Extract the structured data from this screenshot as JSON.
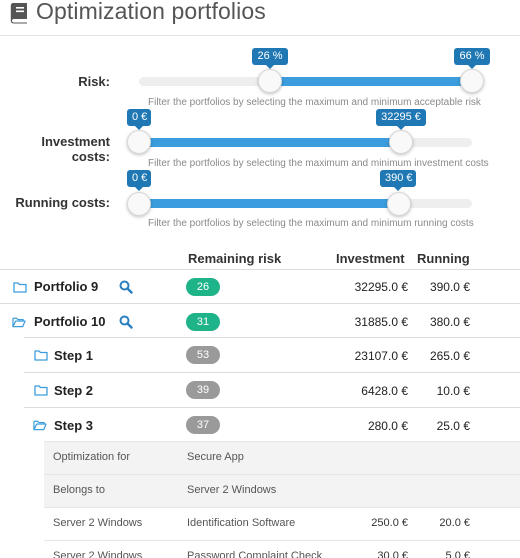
{
  "header": {
    "title": "Optimization portfolios",
    "icon": "book-icon"
  },
  "sliders": [
    {
      "label": "Risk:",
      "min_value": "26 %",
      "max_value": "66 %",
      "min_fraction": 0.26,
      "max_fraction": 0.66,
      "hint": "Filter the portfolios by selecting the maximum and minimum acceptable risk"
    },
    {
      "label": "Investment costs:",
      "min_value": "0 €",
      "max_value": "32295 €",
      "hint": "Filter the portfolios by selecting the maximum and minimum investment costs"
    },
    {
      "label": "Running costs:",
      "min_value": "0 €",
      "max_value": "390 €",
      "hint": "Filter the portfolios by selecting the maximum and minimum running costs"
    }
  ],
  "table": {
    "headers": {
      "risk": "Remaining risk",
      "investment": "Investment",
      "running": "Running"
    },
    "rows": [
      {
        "name": "Portfolio 9",
        "risk": "26",
        "investment": "32295.0 €",
        "running": "390.0 €",
        "expanded": false
      },
      {
        "name": "Portfolio 10",
        "risk": "31",
        "investment": "31885.0 €",
        "running": "380.0 €",
        "expanded": true
      },
      {
        "name": "Step 1",
        "risk": "53",
        "investment": "23107.0 €",
        "running": "265.0 €",
        "expanded": false
      },
      {
        "name": "Step 2",
        "risk": "39",
        "investment": "6428.0 €",
        "running": "10.0 €",
        "expanded": false
      },
      {
        "name": "Step 3",
        "risk": "37",
        "investment": "280.0 €",
        "running": "25.0 €",
        "expanded": true
      }
    ]
  },
  "details": [
    {
      "c1": "Optimization for",
      "c2": "Secure App",
      "c3": "",
      "c4": ""
    },
    {
      "c1": "Belongs to",
      "c2": "Server 2 Windows",
      "c3": "",
      "c4": ""
    },
    {
      "c1": "Server 2 Windows",
      "c2": "Identification Software",
      "c3": "250.0 €",
      "c4": "20.0 €"
    },
    {
      "c1": "Server 2 Windows",
      "c2": "Password Complaint Check",
      "c3": "30.0 €",
      "c4": "5.0 €"
    }
  ],
  "colors": {
    "accent": "#3b9ddd",
    "bubble": "#1f78b4",
    "green_badge": "#1fb38a",
    "gray_badge": "#9a9a9a",
    "folder": "#3b9ddd"
  }
}
